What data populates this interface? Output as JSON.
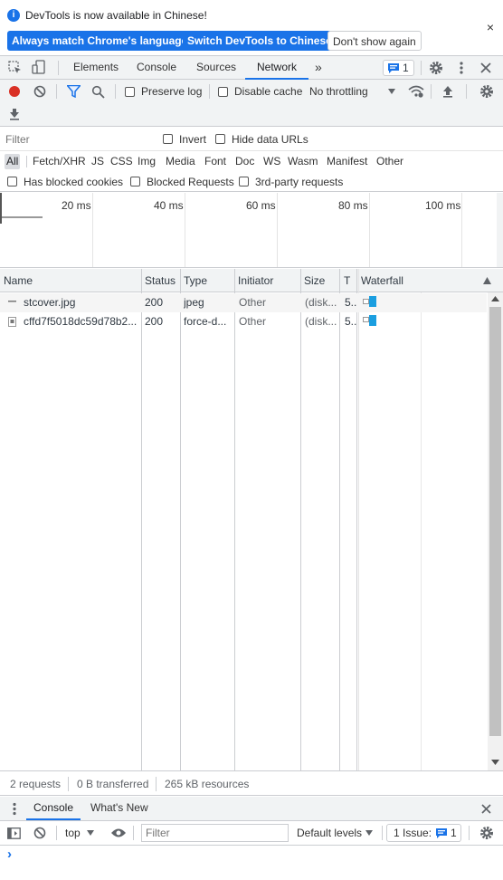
{
  "infobar": {
    "message": "DevTools is now available in Chinese!",
    "btn_match": "Always match Chrome's language",
    "btn_switch": "Switch DevTools to Chinese",
    "btn_dont_show": "Don't show again",
    "close": "×"
  },
  "tabs": {
    "elements": "Elements",
    "console": "Console",
    "sources": "Sources",
    "network": "Network",
    "more": "»",
    "issues_count": "1"
  },
  "toolbar": {
    "preserve_log": "Preserve log",
    "disable_cache": "Disable cache",
    "throttling": "No throttling"
  },
  "filter": {
    "placeholder": "Filter",
    "invert": "Invert",
    "hide_data_urls": "Hide data URLs",
    "types": [
      "All",
      "Fetch/XHR",
      "JS",
      "CSS",
      "Img",
      "Media",
      "Font",
      "Doc",
      "WS",
      "Wasm",
      "Manifest",
      "Other"
    ],
    "has_blocked_cookies": "Has blocked cookies",
    "blocked_requests": "Blocked Requests",
    "third_party": "3rd-party requests"
  },
  "overview": {
    "ticks": [
      "20 ms",
      "40 ms",
      "60 ms",
      "80 ms",
      "100 ms"
    ]
  },
  "table": {
    "headers": {
      "name": "Name",
      "status": "Status",
      "type": "Type",
      "initiator": "Initiator",
      "size": "Size",
      "time": "T",
      "waterfall": "Waterfall"
    },
    "rows": [
      {
        "name": "stcover.jpg",
        "status": "200",
        "type": "jpeg",
        "initiator": "Other",
        "size": "(disk...",
        "time": "5..."
      },
      {
        "name": "cffd7f5018dc59d78b2...",
        "status": "200",
        "type": "force-d...",
        "initiator": "Other",
        "size": "(disk...",
        "time": "5..."
      }
    ]
  },
  "status": {
    "requests": "2 requests",
    "transferred": "0 B transferred",
    "resources": "265 kB resources"
  },
  "drawer": {
    "tab_console": "Console",
    "tab_whats_new": "What's New",
    "close": "×",
    "context": "top",
    "filter_placeholder": "Filter",
    "levels": "Default levels",
    "issues_label": "1 Issue:",
    "issues_count": "1",
    "prompt": "›"
  },
  "colors": {
    "accent": "#1a73e8",
    "record": "#d93025",
    "waterfall_bar": "#1a9ee0"
  }
}
